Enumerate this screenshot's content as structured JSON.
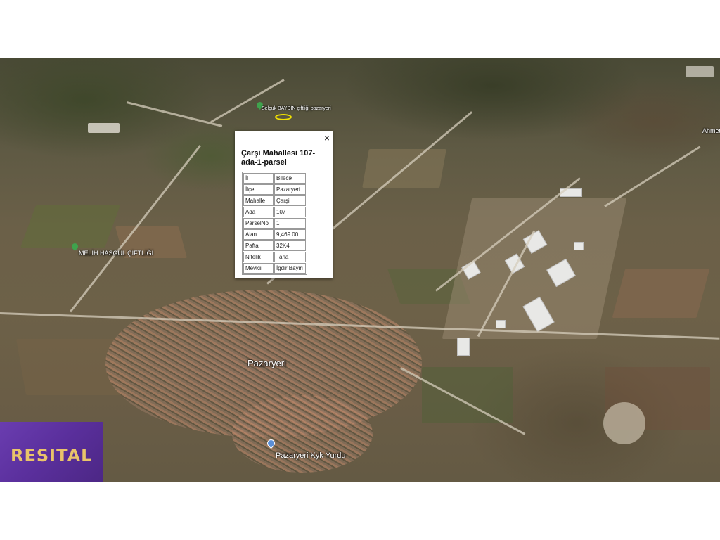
{
  "popup": {
    "title": "Çarşi Mahallesi 107-ada-1-parsel",
    "close_icon": "×",
    "rows": [
      {
        "key": "İl",
        "value": "Bilecik"
      },
      {
        "key": "İlçe",
        "value": "Pazaryeri"
      },
      {
        "key": "Mahalle",
        "value": "Çarşi"
      },
      {
        "key": "Ada",
        "value": "107"
      },
      {
        "key": "ParselNo",
        "value": "1"
      },
      {
        "key": "Alan",
        "value": "9,469.00"
      },
      {
        "key": "Pafta",
        "value": "32K4"
      },
      {
        "key": "Nitelik",
        "value": "Tarla"
      },
      {
        "key": "Mevkii",
        "value": "İğdir Bayiri"
      }
    ]
  },
  "map_labels": {
    "town": "Pazaryeri",
    "farm": "MELİH HASGÜL ÇİFTLİĞİ",
    "dorm": "Pazaryeri Kyk Yurdu",
    "farm_top": "Selçuk BAYDİN çiftliği pazaryeri",
    "right_edge": "Ahmet"
  },
  "logo": {
    "text": "RESITAL",
    "color": "#e9c46a",
    "background": "#5a2f9c"
  },
  "colors": {
    "parcel_outline": "#f2e200"
  }
}
